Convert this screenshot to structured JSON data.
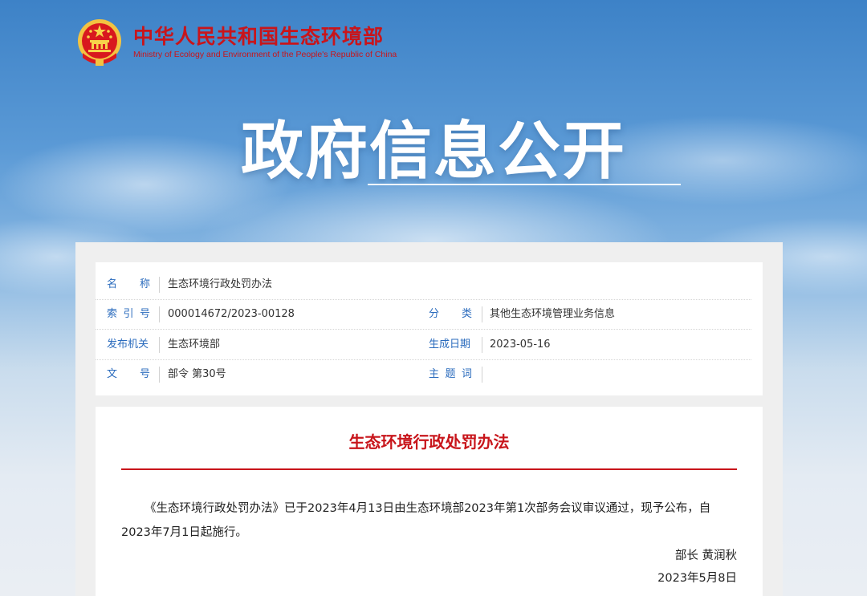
{
  "header": {
    "ministry_cn": "中华人民共和国生态环境部",
    "ministry_en": "Ministry of Ecology and Environment of the People's Republic of China",
    "hero_title": "政府信息公开",
    "logo_icon": "national-emblem-icon"
  },
  "meta": {
    "name_label_a": "名",
    "name_label_b": "称",
    "name_value": "生态环境行政处罚办法",
    "index_label_a": "索",
    "index_label_b": "引",
    "index_label_c": "号",
    "index_value": "000014672/2023-00128",
    "category_label_a": "分",
    "category_label_b": "类",
    "category_value": "其他生态环境管理业务信息",
    "issuer_label": "发布机关",
    "issuer_value": "生态环境部",
    "date_label": "生成日期",
    "date_value": "2023-05-16",
    "docno_label_a": "文",
    "docno_label_b": "号",
    "docno_value": "部令 第30号",
    "subject_label_a": "主",
    "subject_label_b": "题",
    "subject_label_c": "词",
    "subject_value": ""
  },
  "document": {
    "title": "生态环境行政处罚办法",
    "body": "《生态环境行政处罚办法》已于2023年4月13日由生态环境部2023年第1次部务会议审议通过，现予公布，自2023年7月1日起施行。",
    "signer": "部长 黄润秋",
    "sign_date": "2023年5月8日"
  },
  "colors": {
    "brand_red": "#c8151b",
    "label_blue": "#2a6bbd"
  }
}
